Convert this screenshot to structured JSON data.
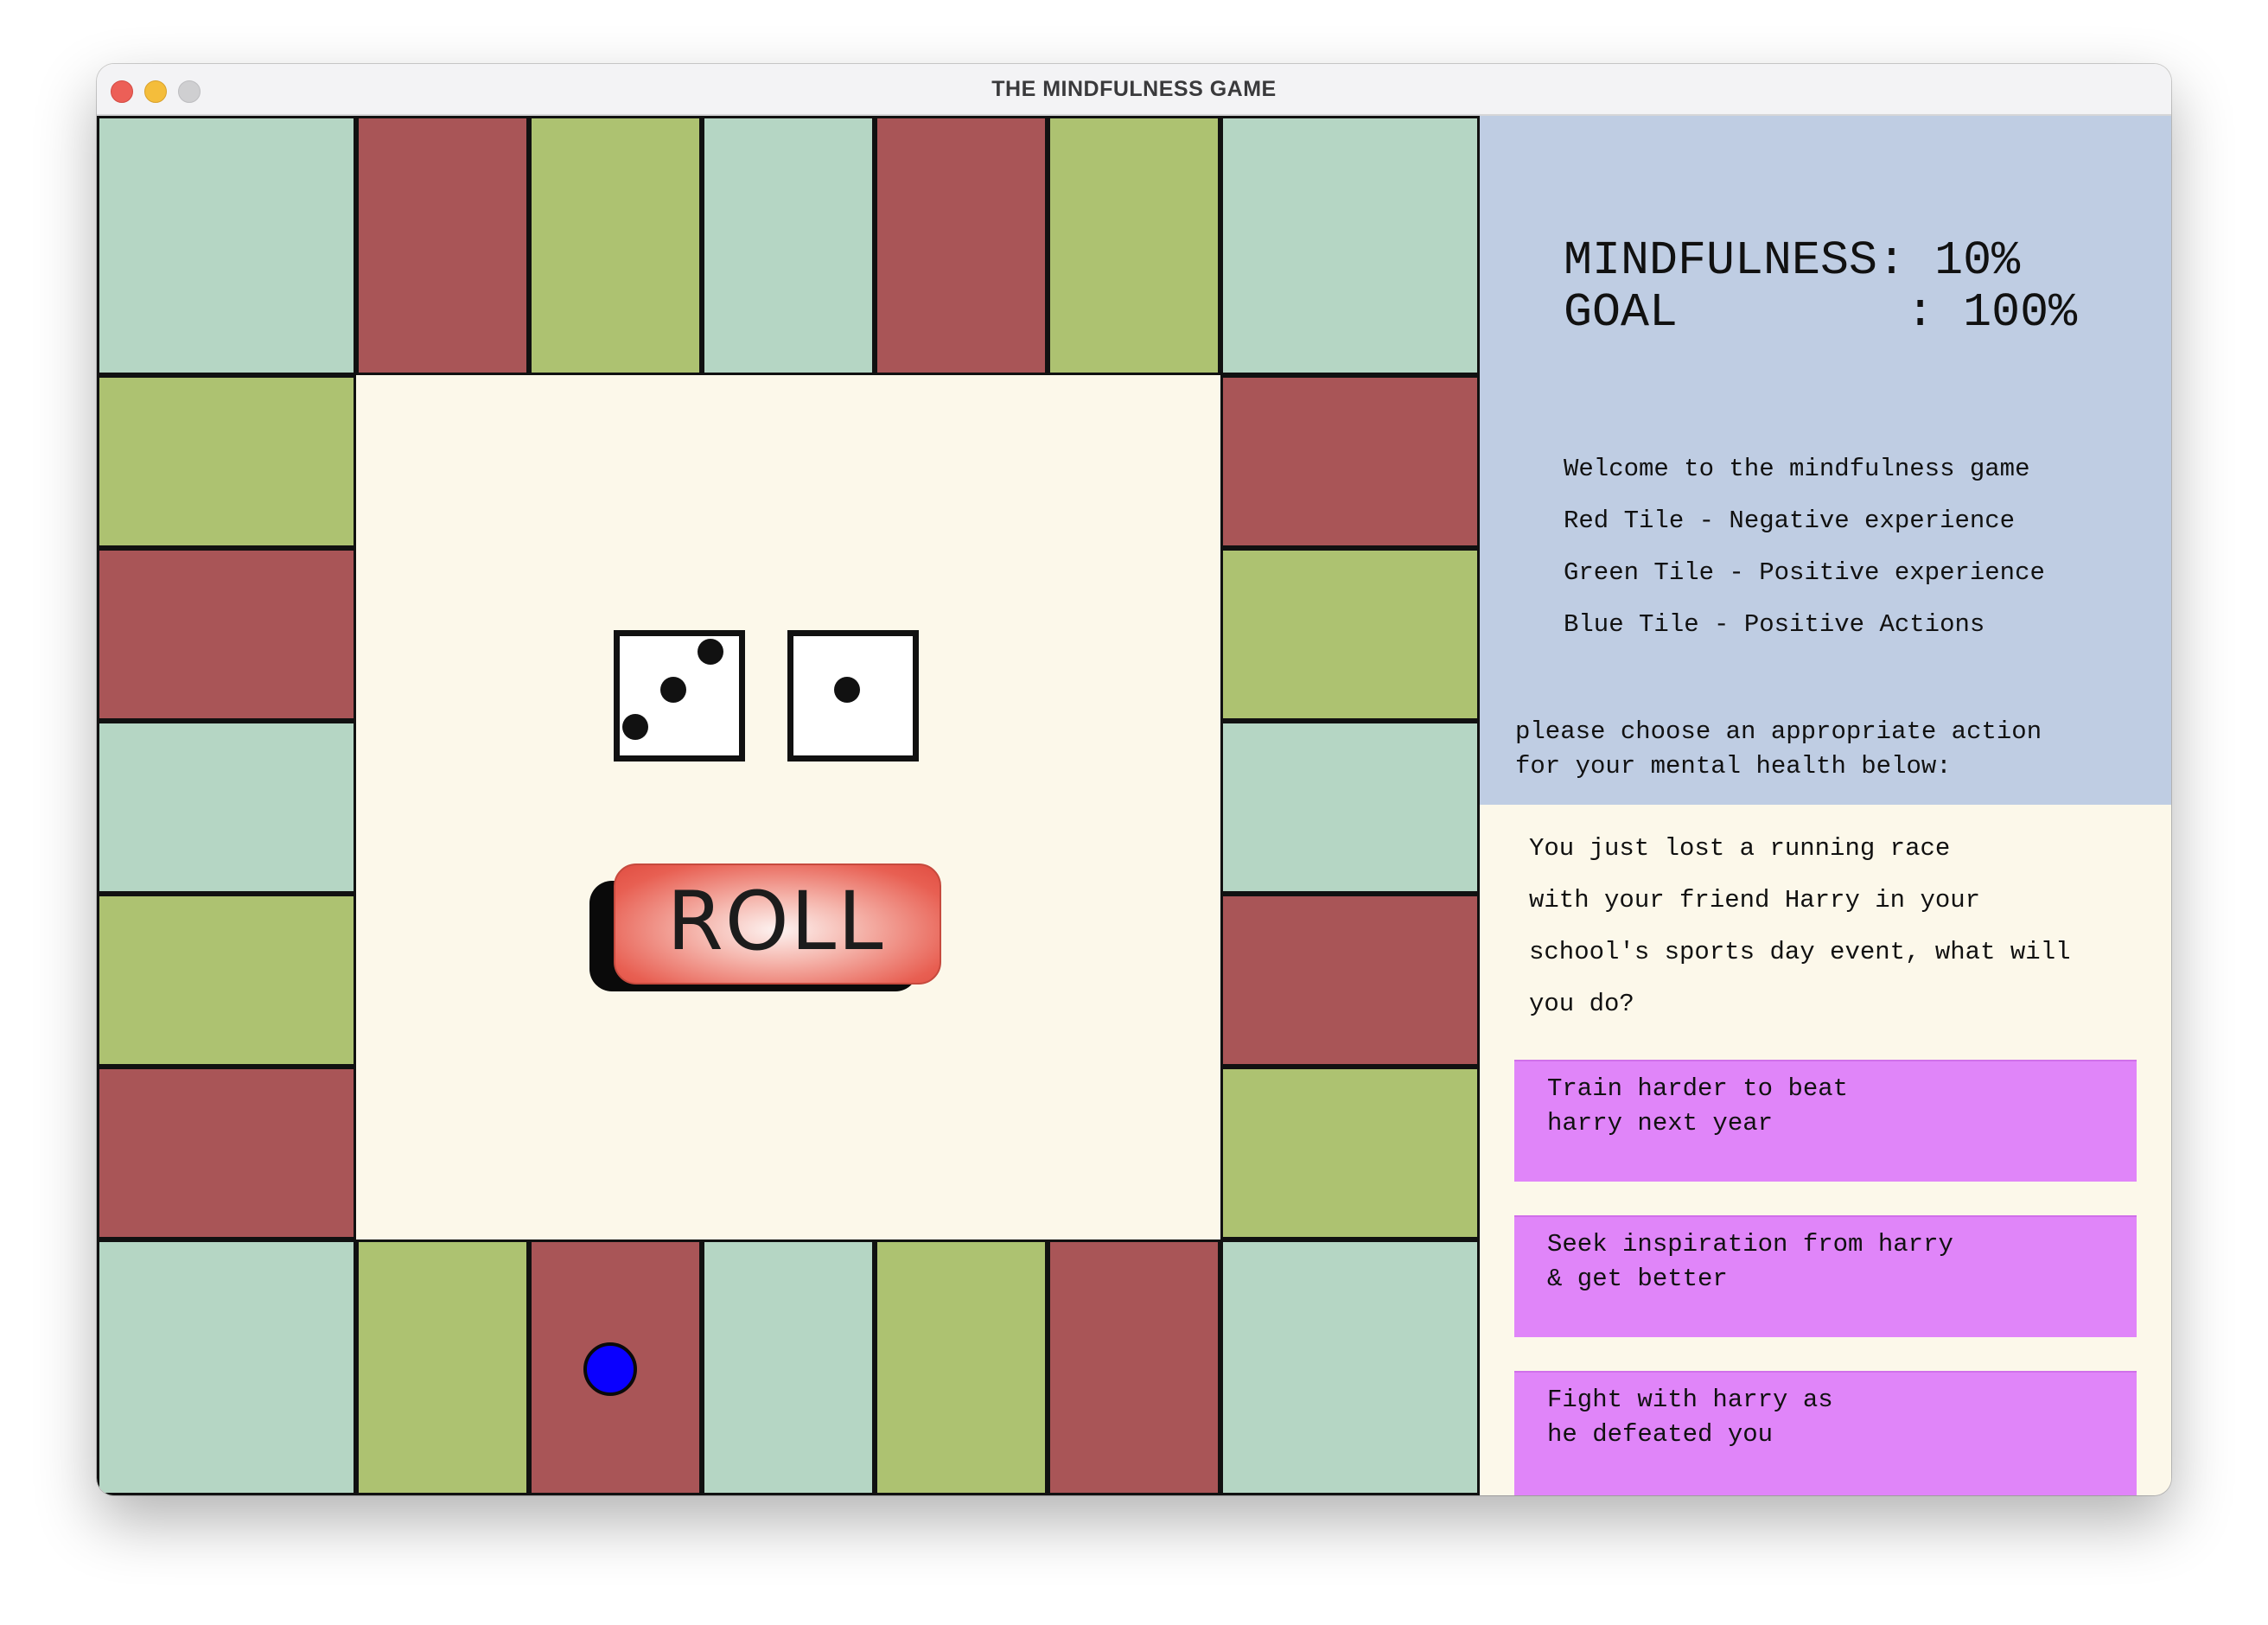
{
  "window": {
    "title": "THE MINDFULNESS GAME"
  },
  "colors": {
    "red_tile": "#a95557",
    "green_tile": "#adc271",
    "blue_tile": "#b5d6c4",
    "board_background": "#fcf8ea",
    "panel_top": "#bfcde3",
    "option_button": "#e085f9",
    "token": "#0a00ff"
  },
  "board": {
    "tiles_clockwise_from_top_left": [
      "blue",
      "red",
      "green",
      "blue",
      "red",
      "green",
      "blue",
      "red",
      "green",
      "blue",
      "red",
      "green",
      "blue",
      "red",
      "green",
      "blue",
      "red",
      "green",
      "blue",
      "red",
      "green",
      "blue",
      "red",
      "green"
    ],
    "token_tile": "bottom-row red tile (third from left)"
  },
  "dice": {
    "die1": 3,
    "die2": 1
  },
  "roll_button": {
    "label": "ROLL"
  },
  "status": {
    "mindfulness_line": "MINDFULNESS: 10%",
    "goal_line": "GOAL        : 100%"
  },
  "rules": [
    "Welcome to the mindfulness game",
    "Red Tile - Negative experience",
    "Green Tile - Positive experience",
    "Blue Tile - Positive Actions"
  ],
  "prompt": "please choose an appropriate action\nfor your mental health below:",
  "scenario": [
    "You just lost a running race",
    "with your friend Harry in your",
    "school's sports day event, what will",
    "you do?"
  ],
  "options": [
    "Train harder to beat\nharry next year",
    "Seek inspiration from harry\n& get better",
    "Fight with harry as\nhe defeated you"
  ]
}
